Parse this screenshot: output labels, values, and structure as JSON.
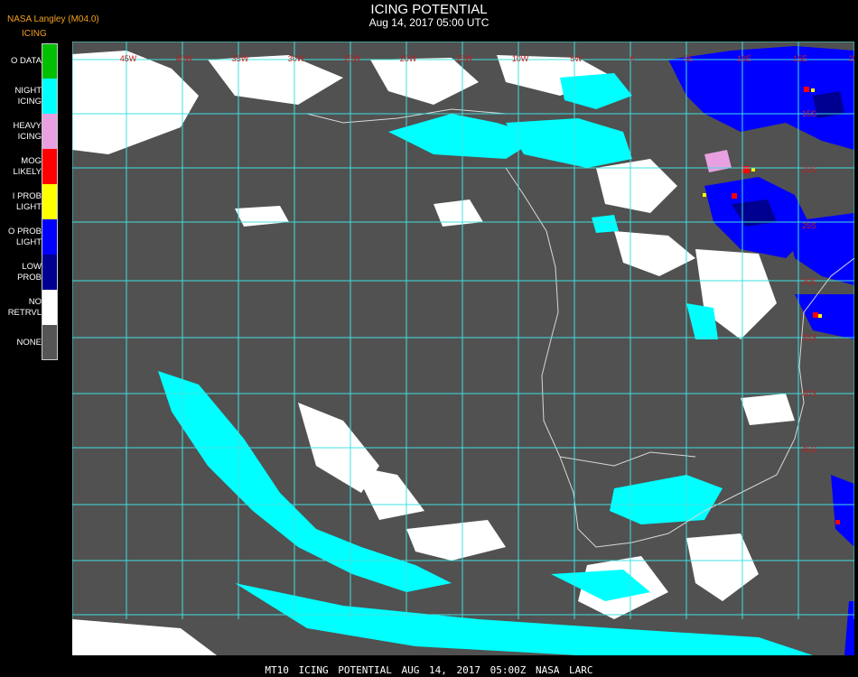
{
  "header": {
    "producer": "NASA Langley (M04.0)",
    "product_short": "ICING",
    "title": "ICING POTENTIAL",
    "timestamp": "Aug 14, 2017 05:00 UTC"
  },
  "legend": [
    {
      "label": "O DATA",
      "color": "#00c000"
    },
    {
      "label": "NIGHT\nICING",
      "color": "#00ffff"
    },
    {
      "label": "HEAVY\nICING",
      "color": "#e8a0e0"
    },
    {
      "label": "MOG\nLIKELY",
      "color": "#ff0000"
    },
    {
      "label": "I PROB\nLIGHT",
      "color": "#ffff00"
    },
    {
      "label": "O PROB\nLIGHT",
      "color": "#0000ff"
    },
    {
      "label": "LOW\nPROB",
      "color": "#000090"
    },
    {
      "label": "NO\nRETRVL",
      "color": "#ffffff"
    },
    {
      "label": "NONE",
      "color": "#555555"
    }
  ],
  "map": {
    "background": "#515151",
    "grid_color": "#40e0e0",
    "coast_color": "#d8d8d8",
    "lon_labels": [
      "45W",
      "40W",
      "35W",
      "30W",
      "25W",
      "20W",
      "15W",
      "10W",
      "5W",
      "0",
      "5E",
      "10E",
      "15E",
      "20E"
    ],
    "lat_labels": [
      "15S",
      "20S",
      "25S",
      "30S",
      "35S",
      "40S",
      "45S"
    ],
    "label_color": "#c02020"
  },
  "footer": {
    "text": "MT10  ICING POTENTIAL   AUG 14, 2017 05:00Z   NASA LARC"
  }
}
